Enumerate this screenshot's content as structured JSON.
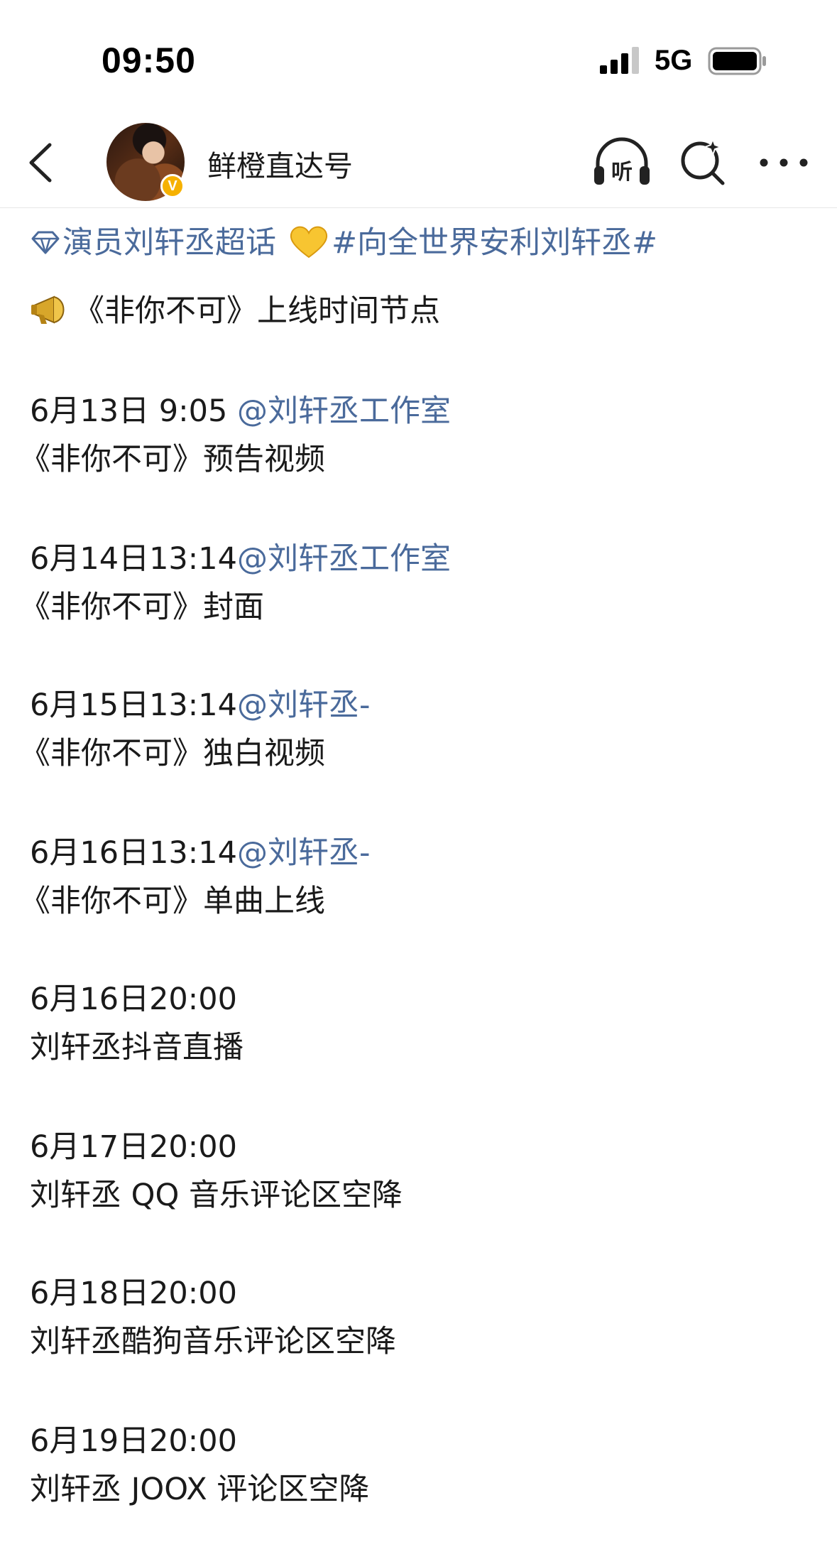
{
  "status_bar": {
    "time": "09:50",
    "network": "5G",
    "icons": [
      "signal-icon",
      "battery-icon"
    ]
  },
  "nav": {
    "account_name": "鲜橙直达号",
    "verified_badge": "V",
    "icons": [
      "back-icon",
      "listen-icon",
      "search-icon",
      "more-icon"
    ],
    "listen_label": "听"
  },
  "colors": {
    "link": "#4a6a9b",
    "text": "#1a1a1a",
    "badge": "#f6b100"
  },
  "post": {
    "super_topic": "演员刘轩丞超话",
    "hashtag": "#向全世界安利刘轩丞#",
    "headline": "《非你不可》上线时间节点",
    "schedule": [
      {
        "date": "6月13日 9:05 ",
        "mention": "@刘轩丞工作室",
        "desc": "《非你不可》预告视频"
      },
      {
        "date": "6月14日13:14",
        "mention": "@刘轩丞工作室",
        "desc": "《非你不可》封面"
      },
      {
        "date": "6月15日13:14",
        "mention": "@刘轩丞-",
        "desc": "《非你不可》独白视频"
      },
      {
        "date": "6月16日13:14",
        "mention": "@刘轩丞-",
        "desc": "《非你不可》单曲上线"
      },
      {
        "date": "6月16日20:00",
        "mention": "",
        "desc": "刘轩丞抖音直播"
      },
      {
        "date": "6月17日20:00",
        "mention": "",
        "desc": "刘轩丞 QQ 音乐评论区空降"
      },
      {
        "date": "6月18日20:00",
        "mention": "",
        "desc": "刘轩丞酷狗音乐评论区空降"
      },
      {
        "date": "6月19日20:00",
        "mention": "",
        "desc": "刘轩丞 JOOX 评论区空降"
      }
    ]
  }
}
